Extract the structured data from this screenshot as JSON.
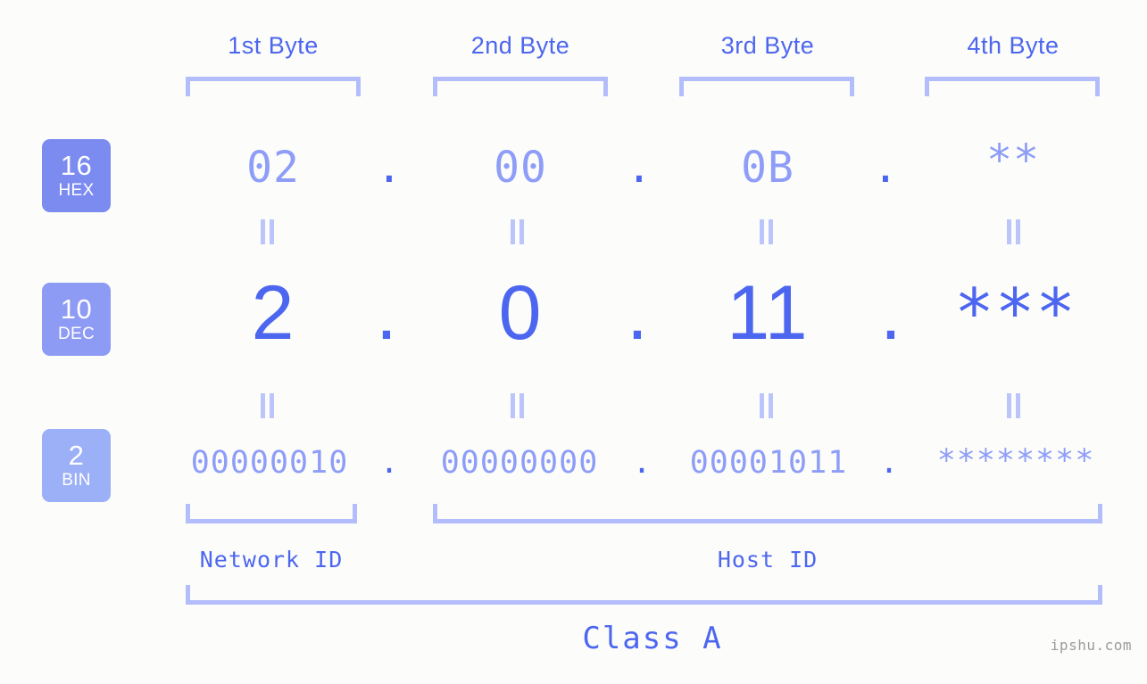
{
  "watermark": "ipshu.com",
  "byte_headers": [
    {
      "label": "1st Byte"
    },
    {
      "label": "2nd Byte"
    },
    {
      "label": "3rd Byte"
    },
    {
      "label": "4th Byte"
    }
  ],
  "radix_badges": [
    {
      "number": "16",
      "name": "HEX",
      "color": "#7b8bf0"
    },
    {
      "number": "10",
      "name": "DEC",
      "color": "#8d9bf4"
    },
    {
      "number": "2",
      "name": "BIN",
      "color": "#9cb0f7"
    }
  ],
  "rows": {
    "hex": {
      "radix_number": "16",
      "radix_name": "HEX",
      "values": [
        "02",
        "00",
        "0B",
        "**"
      ],
      "separator": "."
    },
    "dec": {
      "radix_number": "10",
      "radix_name": "DEC",
      "values": [
        "2",
        "0",
        "11",
        "***"
      ],
      "separator": "."
    },
    "bin": {
      "radix_number": "2",
      "radix_name": "BIN",
      "values": [
        "00000010",
        "00000000",
        "00001011",
        "********"
      ],
      "separator": "."
    }
  },
  "equals_marks": {
    "symbol": "=",
    "count_per_gap": 4
  },
  "id_sections": [
    {
      "label": "Network ID"
    },
    {
      "label": "Host ID"
    }
  ],
  "class_label": "Class A",
  "colors": {
    "background": "#fcfdfa",
    "accent_strong": "#4d66ef",
    "accent_light": "#8e9df7",
    "bracket": "#b3bdfb",
    "equals": "#bcc5fb",
    "watermark": "#9b9b9b"
  }
}
